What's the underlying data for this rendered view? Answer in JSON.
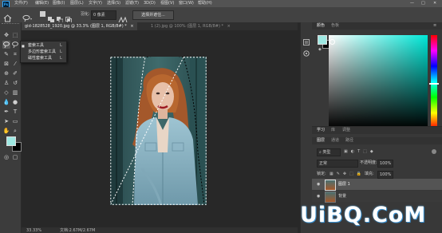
{
  "app": {
    "logo": "Ps",
    "accent": "#31a8ff"
  },
  "menubar": {
    "items": [
      "文件(F)",
      "编辑(E)",
      "图像(I)",
      "图层(L)",
      "文字(Y)",
      "选择(S)",
      "滤镜(T)",
      "3D(D)",
      "视图(V)",
      "窗口(W)",
      "帮助(H)"
    ],
    "window_controls": [
      "—",
      "□",
      "✕"
    ]
  },
  "optionsbar": {
    "feather_label": "羽化:",
    "feather_value": "0 像素",
    "select_mask_button": "选择并遮住..."
  },
  "tabs": [
    {
      "label": "gid-1828528_1920.jpg @ 33.3% (图层 1, RGB/8#) *",
      "close": "×",
      "active": true
    },
    {
      "label": "1 (2).jpg @ 100% (图层 1, RGB/8#) *",
      "close": "×",
      "active": false
    }
  ],
  "tool_flyout": {
    "items": [
      {
        "label": "套索工具",
        "shortcut": "L",
        "selected": true
      },
      {
        "label": "多边形套索工具",
        "shortcut": "L",
        "selected": false
      },
      {
        "label": "磁性套索工具",
        "shortcut": "L",
        "selected": false
      }
    ]
  },
  "status": {
    "zoom": "33.33%",
    "doc_info": "文档:2.67M/2.67M"
  },
  "color_panel": {
    "tabs": [
      "颜色",
      "色板"
    ],
    "foreground": "#9ee8e2",
    "background": "#000000"
  },
  "learn_tabs": [
    "学习",
    "库",
    "调整"
  ],
  "layers_panel": {
    "tabs": [
      "图层",
      "通道",
      "路径"
    ],
    "filter_kind": "类型",
    "blend_mode": "正常",
    "opacity_label": "不透明度:",
    "opacity_value": "100%",
    "lock_label": "锁定:",
    "fill_label": "填充:",
    "fill_value": "100%",
    "layers": [
      {
        "name": "图层 1",
        "selected": true
      },
      {
        "name": "背景",
        "selected": false
      }
    ]
  },
  "watermark": {
    "text": "UiBQ.CoM"
  }
}
